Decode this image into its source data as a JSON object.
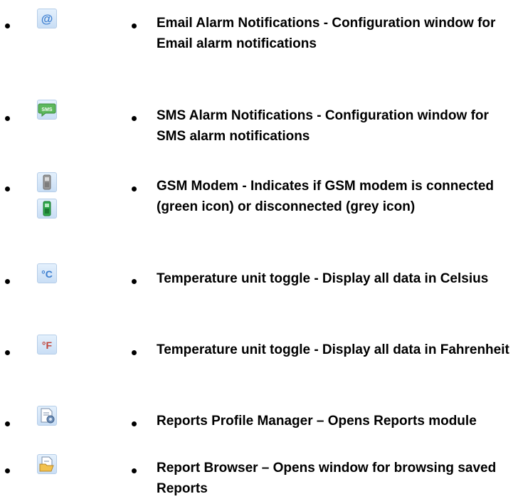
{
  "items": [
    {
      "icon": "email-at-icon",
      "text": "Email Alarm Notifications - Configuration window for Email alarm notifications"
    },
    {
      "icon": "sms-bubble-icon",
      "text": "SMS Alarm Notifications - Configuration window for SMS alarm notifications"
    },
    {
      "icon": "gsm-modem-icon",
      "text": "GSM Modem - Indicates if GSM modem is connected (green icon) or disconnected (grey icon)"
    },
    {
      "icon": "celsius-icon",
      "text": "Temperature unit toggle - Display all data in Celsius"
    },
    {
      "icon": "fahrenheit-icon",
      "text": "Temperature unit toggle - Display all data in Fahrenheit"
    },
    {
      "icon": "reports-profile-icon",
      "text": "Reports Profile Manager – Opens Reports module"
    },
    {
      "icon": "report-browser-icon",
      "text": "Report Browser – Opens window for browsing saved Reports"
    }
  ],
  "icon_labels": {
    "email": "@",
    "sms": "SMS",
    "celsius": "°C",
    "fahrenheit": "°F"
  },
  "colors": {
    "icon_bg": "#c9def5",
    "gsm_connected": "#2fa84a",
    "gsm_disconnected": "#9a9a9a"
  }
}
